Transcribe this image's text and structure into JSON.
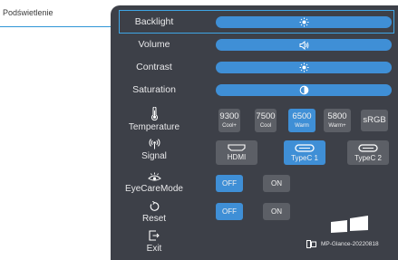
{
  "callout": {
    "label": "Podświetlenie"
  },
  "menu": {
    "rows": [
      {
        "label": "Backlight",
        "icon": "sun-icon"
      },
      {
        "label": "Volume",
        "icon": "speaker-icon"
      },
      {
        "label": "Contrast",
        "icon": "sun-icon"
      },
      {
        "label": "Saturation",
        "icon": "half-circle-icon"
      }
    ],
    "temperature": {
      "label": "Temperature",
      "icon": "thermometer-icon",
      "options": [
        {
          "value": "9300",
          "sub": "Cool+"
        },
        {
          "value": "7500",
          "sub": "Cool"
        },
        {
          "value": "6500",
          "sub": "Warm",
          "selected": true
        },
        {
          "value": "5800",
          "sub": "Warm+"
        },
        {
          "value": "sRGB",
          "sub": ""
        }
      ]
    },
    "signal": {
      "label": "Signal",
      "icon": "signal-icon",
      "options": [
        {
          "label": "HDMI"
        },
        {
          "label": "TypeC 1",
          "selected": true
        },
        {
          "label": "TypeC 2"
        }
      ]
    },
    "eyecare": {
      "label": "EyeCareMode",
      "icon": "eye-icon",
      "off": "OFF",
      "on": "ON",
      "selected": "OFF"
    },
    "reset": {
      "label": "Reset",
      "icon": "reset-icon",
      "off": "OFF",
      "on": "ON",
      "selected": "OFF"
    },
    "exit": {
      "label": "Exit",
      "icon": "exit-icon"
    },
    "footer": {
      "device": "MP-Glance-20220818",
      "icon": "device-icon",
      "logo": "windows-logo-icon"
    }
  },
  "colors": {
    "panel": "#3d4048",
    "accent": "#3f8fd6",
    "option": "#5c5f66",
    "highlight": "#3ea6e6"
  }
}
